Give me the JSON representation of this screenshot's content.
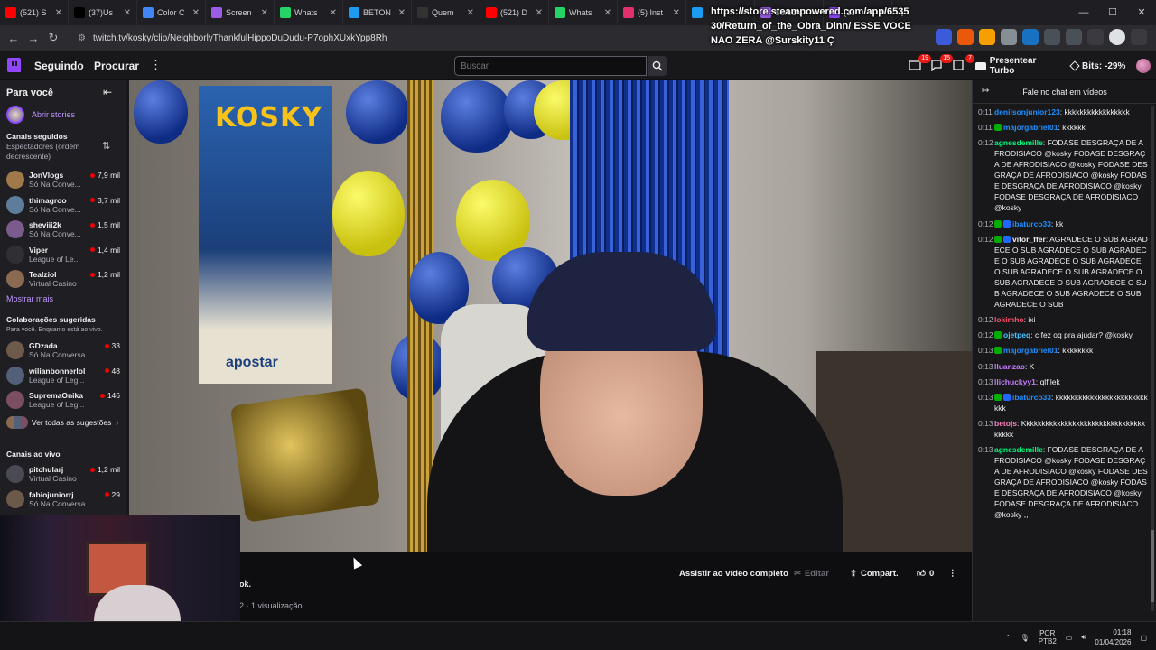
{
  "browser": {
    "tabs": [
      {
        "label": "(521) S",
        "icon": "youtube-icon",
        "color": "#ff0000"
      },
      {
        "label": "(37)Us",
        "icon": "tiktok-icon",
        "color": "#000000"
      },
      {
        "label": "Color C",
        "icon": "color-icon",
        "color": "#4285f4"
      },
      {
        "label": "Screen",
        "icon": "pen-icon",
        "color": "#9b5de5"
      },
      {
        "label": "Whats",
        "icon": "whatsapp-icon",
        "color": "#25d366"
      },
      {
        "label": "BETON",
        "icon": "bird-icon",
        "color": "#1d9bf0"
      },
      {
        "label": "Quem",
        "icon": "dots-icon",
        "color": "#333333"
      },
      {
        "label": "(521) D",
        "icon": "youtube-icon",
        "color": "#ff0000"
      },
      {
        "label": "Whats",
        "icon": "whatsapp-icon",
        "color": "#25d366"
      },
      {
        "label": "(5) Inst",
        "icon": "instagram-icon",
        "color": "#e1306c"
      },
      {
        "label": "",
        "icon": "bird-icon",
        "color": "#1d9bf0"
      },
      {
        "label": "Screen",
        "icon": "pen-icon",
        "color": "#9b5de5"
      },
      {
        "label": "(15",
        "icon": "twitch-icon",
        "color": "#9147ff"
      }
    ],
    "url": "twitch.tv/kosky/clip/NeighborlyThankfulHippoDuDudu-P7ophXUxkYpp8Rh",
    "overlay_lines": [
      "https://store.steampowered.com/app/6535",
      "30/Return_of_the_Obra_Dinn/ ESSE VOCE",
      "NAO ZERA @Surskity11 Ç"
    ]
  },
  "topnav": {
    "following": "Seguindo",
    "browse": "Procurar",
    "search_placeholder": "Buscar",
    "badges": {
      "inbox": "19",
      "notifications": "15",
      "activity": "7"
    },
    "turbo": "Presentear Turbo",
    "bits": "Bits: -29%"
  },
  "sidebar": {
    "title": "Para você",
    "stories": "Abrir stories",
    "followed_title": "Canais seguidos",
    "followed_sub": "Espectadores (ordem decrescente)",
    "followed": [
      {
        "name": "JonVlogs",
        "game": "Só Na Conve...",
        "viewers": "7,9 mil",
        "color": "#a0784a"
      },
      {
        "name": "thimagroo",
        "game": "Só Na Conve...",
        "viewers": "3,7 mil",
        "color": "#5e7d9a"
      },
      {
        "name": "sheviii2k",
        "game": "Só Na Conve...",
        "viewers": "1,5 mil",
        "color": "#7b5a8c"
      },
      {
        "name": "Viper",
        "game": "League of Le...",
        "viewers": "1,4 mil",
        "color": "#2f2f35"
      },
      {
        "name": "Tealziol",
        "game": "Virtual Casino",
        "viewers": "1,2 mil",
        "color": "#8a6b52"
      }
    ],
    "show_more": "Mostrar mais",
    "collab_title": "Colaborações sugeridas",
    "collab_sub": "Para você. Enquanto está ao vivo.",
    "collabs": [
      {
        "name": "GDzada",
        "game": "Só Na Conversa",
        "viewers": "33",
        "color": "#6d5a4b"
      },
      {
        "name": "wilianbonnerlol",
        "game": "League of Leg...",
        "viewers": "48",
        "color": "#52607a"
      },
      {
        "name": "SupremaOnika",
        "game": "League of Leg...",
        "viewers": "146",
        "color": "#7a4f63"
      }
    ],
    "see_all": "Ver todas as sugestões",
    "live_title": "Canais ao vivo",
    "live": [
      {
        "name": "pitchularj",
        "game": "Virtual Casino",
        "viewers": "1,2 mil",
        "color": "#4a4a55"
      },
      {
        "name": "fabiojuniorrj",
        "game": "Só Na Conversa",
        "viewers": "29",
        "color": "#6b5a4a"
      }
    ]
  },
  "video": {
    "poster_title": "KOSKY",
    "poster_brand": "apostar"
  },
  "clip": {
    "title_tail": "ok.",
    "views": "2 · 1 visualização",
    "watch_full": "Assistir ao vídeo completo",
    "edit": "Editar",
    "share": "Compart.",
    "likes": "0"
  },
  "chat": {
    "header": "Fale no chat em vídeos",
    "messages": [
      {
        "time": "0:11",
        "user": "denilsonjunior123",
        "color": "#1e90ff",
        "badges": 0,
        "text": "kkkkkkkkkkkkkkkkk"
      },
      {
        "time": "0:11",
        "user": "majorgabriel01",
        "color": "#1e90ff",
        "badges": 1,
        "text": "kkkkkk"
      },
      {
        "time": "0:12",
        "user": "agnesdemille",
        "color": "#00ff7f",
        "badges": 0,
        "text": "FODASE DESGRAÇA DE AFRODISIACO @kosky FODASE DESGRAÇA DE AFRODISIACO @kosky FODASE DESGRAÇA DE AFRODISIACO @kosky FODASE DESGRAÇA DE AFRODISIACO @kosky FODASE DESGRAÇA DE AFRODISIACO @kosky"
      },
      {
        "time": "0:12",
        "user": "ibaturco33",
        "color": "#1e90ff",
        "badges": 2,
        "text": "kk"
      },
      {
        "time": "0:12",
        "user": "vitor_ffer",
        "color": "#efeff1",
        "badges": 2,
        "text": "AGRADECE O SUB AGRADECE O SUB AGRADECE O SUB AGRADECE O SUB AGRADECE O SUB AGRADECE O SUB AGRADECE O SUB AGRADECE O SUB AGRADECE O SUB AGRADECE O SUB AGRADECE O SUB AGRADECE O SUB AGRADECE O SUB"
      },
      {
        "time": "0:12",
        "user": "lokimho",
        "color": "#ff4f6f",
        "badges": 0,
        "text": "ixi"
      },
      {
        "time": "0:12",
        "user": "ojetpeq",
        "color": "#4fc3ff",
        "badges": 1,
        "text": "c fez oq pra ajudar? @kosky"
      },
      {
        "time": "0:13",
        "user": "majorgabriel01",
        "color": "#1e90ff",
        "badges": 1,
        "text": "kkkkkkkk"
      },
      {
        "time": "0:13",
        "user": "lluanzao",
        "color": "#c77dff",
        "badges": 0,
        "text": "K"
      },
      {
        "time": "0:13",
        "user": "llichuckyy1",
        "color": "#c77dff",
        "badges": 0,
        "text": "qlf lek"
      },
      {
        "time": "0:13",
        "user": "ibaturco33",
        "color": "#1e90ff",
        "badges": 2,
        "text": "kkkkkkkkkkkkkkkkkkkkkkkkkkk"
      },
      {
        "time": "0:13",
        "user": "betojs",
        "color": "#ff7fbf",
        "badges": 0,
        "text": "Kkkkkkkkkkkkkkkkkkkkkkkkkkkkkkkkkkkkk"
      },
      {
        "time": "0:13",
        "user": "agnesdemille",
        "color": "#00ff7f",
        "badges": 0,
        "text": "FODASE DESGRAÇA DE AFRODISIACO @kosky FODASE DESGRAÇA DE AFRODISIACO @kosky FODASE DESGRAÇA DE AFRODISIACO @kosky FODASE DESGRAÇA DE AFRODISIACO @kosky FODASE DESGRAÇA DE AFRODISIACO @kosky ,,"
      }
    ]
  },
  "taskbar": {
    "lang1": "POR",
    "lang2": "PTB2",
    "time": "01:18",
    "date": "01/04/2026"
  }
}
